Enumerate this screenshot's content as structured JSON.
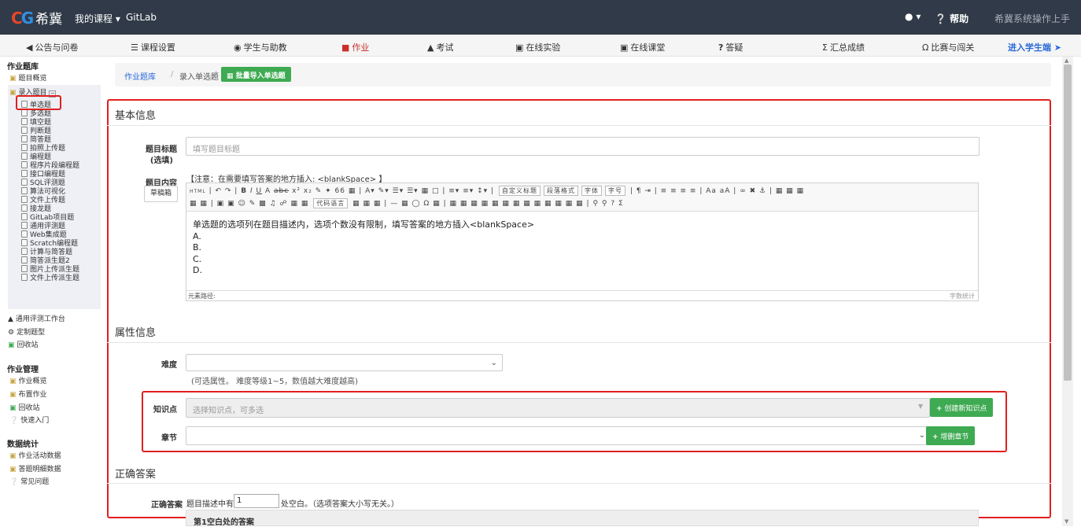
{
  "topbar": {
    "logo_mark": "CG",
    "logo_text": "希冀",
    "my_course": "我的课程 ▾",
    "gitlab": "GitLab",
    "user_caret": "▾",
    "help": "帮助",
    "manual": "希冀系统操作上手"
  },
  "nav": {
    "items": [
      {
        "label": "公告与问卷",
        "icon": "megaphone-icon"
      },
      {
        "label": "课程设置",
        "icon": "list-icon"
      },
      {
        "label": "学生与助教",
        "icon": "users-icon"
      },
      {
        "label": "作业",
        "icon": "assignment-icon"
      },
      {
        "label": "考试",
        "icon": "exam-icon"
      },
      {
        "label": "在线实验",
        "icon": "lab-icon"
      },
      {
        "label": "在线课堂",
        "icon": "classroom-icon"
      },
      {
        "label": "答疑",
        "icon": "question-icon"
      },
      {
        "label": "汇总成绩",
        "icon": "sum-icon"
      },
      {
        "label": "比赛与闯关",
        "icon": "omega-icon"
      }
    ],
    "student_link": "进入学生端"
  },
  "sidebar": {
    "section1": "作业题库",
    "overview": "题目概览",
    "enter": "录入题目",
    "types": [
      "单选题",
      "多选题",
      "填空题",
      "判断题",
      "简答题",
      "拍照上传题",
      "编程题",
      "程序片段编程题",
      "接口编程题",
      "SQL评测题",
      "算法可视化",
      "文件上传题",
      "接龙题",
      "GitLab项目题",
      "通用评测题",
      "Web集成题",
      "Scratch编程题",
      "计算与简答题",
      "简答派生题2",
      "图片上传派生题",
      "文件上传派生题"
    ],
    "workbench": "通用评测工作台",
    "custom": "定制题型",
    "recycle": "回收站",
    "section2": "作业管理",
    "hw_overview": "作业概览",
    "hw_assign": "布置作业",
    "hw_recycle": "回收站",
    "quick_start": "快速入门",
    "section3": "数据统计",
    "stat_activity": "作业活动数据",
    "stat_detail": "答题明细数据",
    "faq": "常见问题"
  },
  "breadcrumb": {
    "root": "作业题库",
    "sep": "/",
    "current": "录入单选题",
    "import_button": "批量导入单选题"
  },
  "basic": {
    "section": "基本信息",
    "title_label": "题目标题",
    "title_optional": "(选填)",
    "title_placeholder": "填写题目标题",
    "content_label": "题目内容",
    "draft_button": "草稿箱",
    "note": "【注意：在需要填写答案的地方插入: <blankSpace> 】",
    "editor_lines": [
      "单选题的选项列在题目描述内，选项个数没有限制，填写答案的地方插入<blankSpace>",
      "A.",
      "B.",
      "C.",
      "D."
    ],
    "path_label": "元素路径:",
    "word_count": "字数统计",
    "toolbar_selects": [
      "自定义标题",
      "段落格式",
      "字体",
      "字号"
    ],
    "toolbar_code_lang": "代码语言"
  },
  "attr": {
    "section": "属性信息",
    "difficulty_label": "难度",
    "difficulty_hint": "(可选属性。 难度等级1~5，数值越大难度越高)",
    "knowledge_label": "知识点",
    "knowledge_placeholder": "选择知识点，可多选",
    "create_knowledge": "创建新知识点",
    "chapter_label": "章节",
    "add_chapter": "增删章节"
  },
  "answer": {
    "section": "正确答案",
    "label": "正确答案",
    "prefix": "题目描述中有",
    "count": "1",
    "suffix": "处空白。（选项答案大小写无关。）",
    "blank_header": "第1空白处的答案"
  },
  "colors": {
    "topbar": "#303a48",
    "accent_green": "#3eaa52",
    "highlight_red": "#e02020",
    "active_nav": "#c9302c",
    "link_blue": "#2a6ad8"
  }
}
